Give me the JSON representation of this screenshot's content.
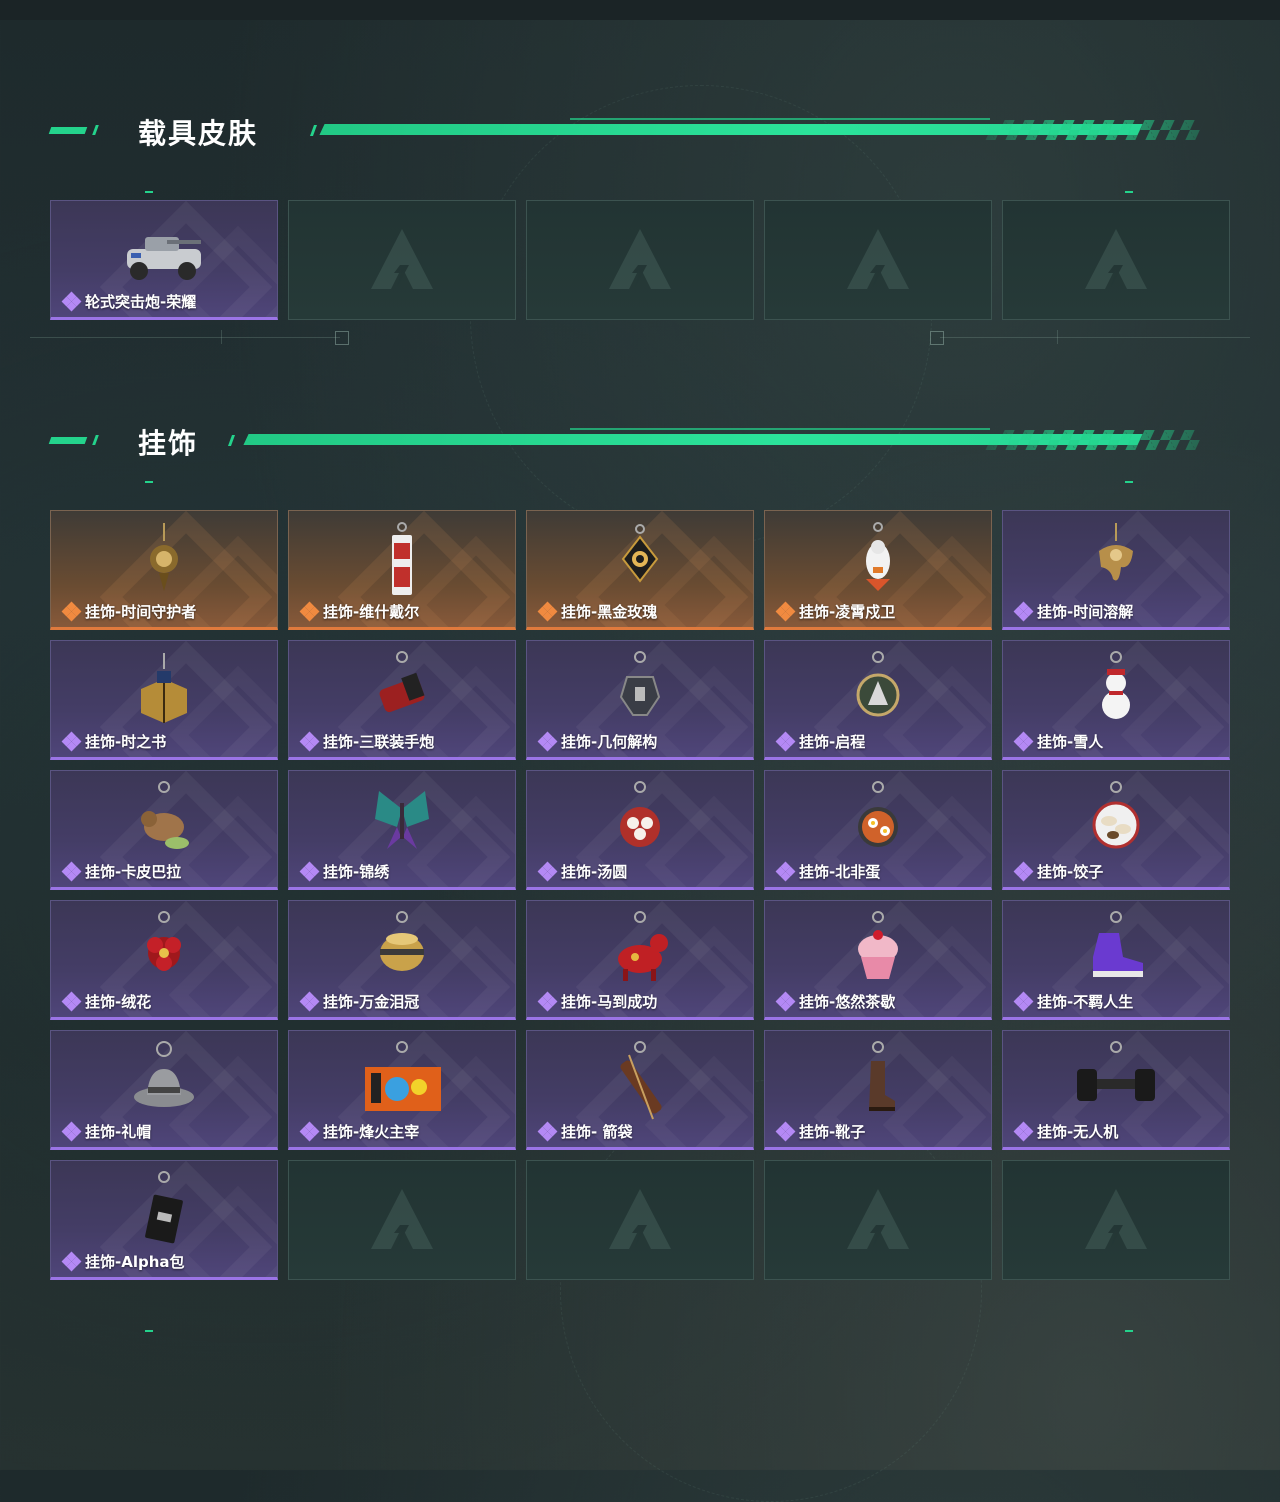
{
  "sections": [
    {
      "title": "载具皮肤",
      "items": [
        {
          "label": "轮式突击炮-荣耀",
          "rarity": "purple",
          "icon": "armored-vehicle-icon"
        },
        {
          "empty": true
        },
        {
          "empty": true
        },
        {
          "empty": true
        },
        {
          "empty": true
        }
      ]
    },
    {
      "title": "挂饰",
      "items": [
        {
          "label": "挂饰-时间守护者",
          "rarity": "gold",
          "icon": "clock-guardian-charm-icon"
        },
        {
          "label": "挂饰-维什戴尔",
          "rarity": "gold",
          "icon": "tag-charm-icon"
        },
        {
          "label": "挂饰-黑金玫瑰",
          "rarity": "gold",
          "icon": "black-gold-rose-charm-icon"
        },
        {
          "label": "挂饰-凌霄戍卫",
          "rarity": "gold",
          "icon": "guardian-figure-charm-icon"
        },
        {
          "label": "挂饰-时间溶解",
          "rarity": "purple",
          "icon": "melting-clock-charm-icon"
        },
        {
          "label": "挂饰-时之书",
          "rarity": "purple",
          "icon": "book-charm-icon"
        },
        {
          "label": "挂饰-三联装手炮",
          "rarity": "purple",
          "icon": "hand-cannon-charm-icon"
        },
        {
          "label": "挂饰-几何解构",
          "rarity": "purple",
          "icon": "geometric-charm-icon"
        },
        {
          "label": "挂饰-启程",
          "rarity": "purple",
          "icon": "medal-charm-icon"
        },
        {
          "label": "挂饰-雪人",
          "rarity": "purple",
          "icon": "snowman-charm-icon"
        },
        {
          "label": "挂饰-卡皮巴拉",
          "rarity": "purple",
          "icon": "capybara-charm-icon"
        },
        {
          "label": "挂饰-锦绣",
          "rarity": "purple",
          "icon": "butterfly-charm-icon"
        },
        {
          "label": "挂饰-汤圆",
          "rarity": "purple",
          "icon": "rice-ball-bowl-charm-icon"
        },
        {
          "label": "挂饰-北非蛋",
          "rarity": "purple",
          "icon": "shakshuka-pan-charm-icon"
        },
        {
          "label": "挂饰-饺子",
          "rarity": "purple",
          "icon": "dumpling-plate-charm-icon"
        },
        {
          "label": "挂饰-绒花",
          "rarity": "purple",
          "icon": "red-flower-charm-icon"
        },
        {
          "label": "挂饰-万金泪冠",
          "rarity": "purple",
          "icon": "golden-crown-charm-icon"
        },
        {
          "label": "挂饰-马到成功",
          "rarity": "purple",
          "icon": "red-horse-charm-icon"
        },
        {
          "label": "挂饰-悠然茶歇",
          "rarity": "purple",
          "icon": "cupcake-charm-icon"
        },
        {
          "label": "挂饰-不羁人生",
          "rarity": "purple",
          "icon": "sneaker-charm-icon"
        },
        {
          "label": "挂饰-礼帽",
          "rarity": "purple",
          "icon": "fedora-hat-charm-icon"
        },
        {
          "label": "挂饰-烽火主宰",
          "rarity": "purple",
          "icon": "graffiti-container-charm-icon"
        },
        {
          "label": "挂饰- 箭袋",
          "rarity": "purple",
          "icon": "quiver-charm-icon"
        },
        {
          "label": "挂饰-靴子",
          "rarity": "purple",
          "icon": "boot-charm-icon"
        },
        {
          "label": "挂饰-无人机",
          "rarity": "purple",
          "icon": "drone-charm-icon"
        },
        {
          "label": "挂饰-Alpha包",
          "rarity": "purple",
          "icon": "alpha-pouch-charm-icon"
        },
        {
          "empty": true
        },
        {
          "empty": true
        },
        {
          "empty": true
        },
        {
          "empty": true
        }
      ]
    }
  ],
  "colors": {
    "accent_green": "#24d38c",
    "purple_rarity": "#9b74e6",
    "gold_rarity": "#e07a3d"
  }
}
